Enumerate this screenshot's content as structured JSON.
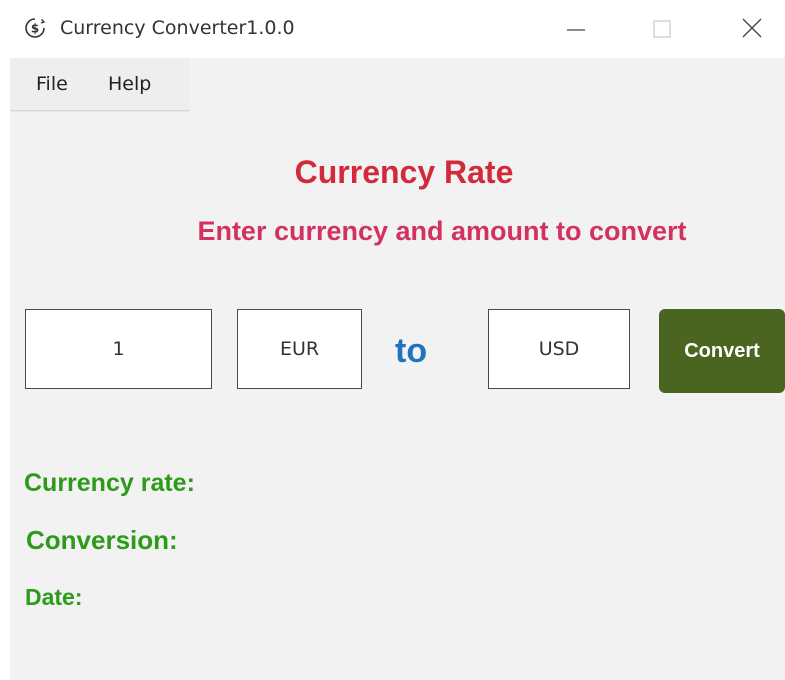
{
  "window": {
    "title": "Currency Converter1.0.0"
  },
  "menu": {
    "file": "File",
    "help": "Help"
  },
  "header": {
    "title": "Currency Rate",
    "subtitle": "Enter currency and amount to convert"
  },
  "form": {
    "amount": "1",
    "from_currency": "EUR",
    "to_label": "to",
    "to_currency": "USD",
    "convert_label": "Convert"
  },
  "results": {
    "rate_label": "Currency rate:",
    "conversion_label": "Conversion:",
    "date_label": "Date:"
  },
  "colors": {
    "title": "#d12a3a",
    "subtitle": "#d23162",
    "to_label": "#1f74bd",
    "convert_button": "#4a6520",
    "result_labels": "#2e9a1a"
  },
  "icons": {
    "app": "dollar-coin-icon",
    "minimize": "minimize-icon",
    "maximize": "maximize-icon",
    "close": "close-icon"
  }
}
